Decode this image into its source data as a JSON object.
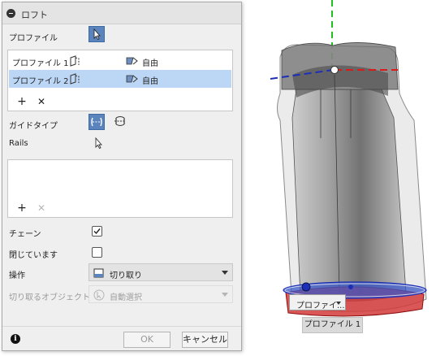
{
  "dialog": {
    "title": "ロフト",
    "profile_label": "プロファイル",
    "profiles": [
      {
        "name": "プロファイル 1",
        "condition": "自由",
        "selected": false
      },
      {
        "name": "プロファイル 2",
        "condition": "自由",
        "selected": true
      }
    ],
    "guide_type_label": "ガイドタイプ",
    "rails_label": "Rails",
    "chain_label": "チェーン",
    "chain_checked": true,
    "closed_label": "閉じています",
    "closed_checked": false,
    "operation_label": "操作",
    "operation_value": "切り取り",
    "objects_to_cut_label": "切り取るオブジェクト",
    "objects_to_cut_value": "自動選択",
    "ok_label": "OK",
    "cancel_label": "キャンセル"
  },
  "viewport": {
    "profile_dropdown_label": "プロファイ...",
    "profile_tooltip": "プロファイル 1"
  },
  "colors": {
    "accent_blue": "#5b84bd",
    "selection_row": "#bcd6f5",
    "axis_red": "#d81b1b",
    "axis_blue": "#1d2fb8",
    "axis_green": "#21c021"
  }
}
